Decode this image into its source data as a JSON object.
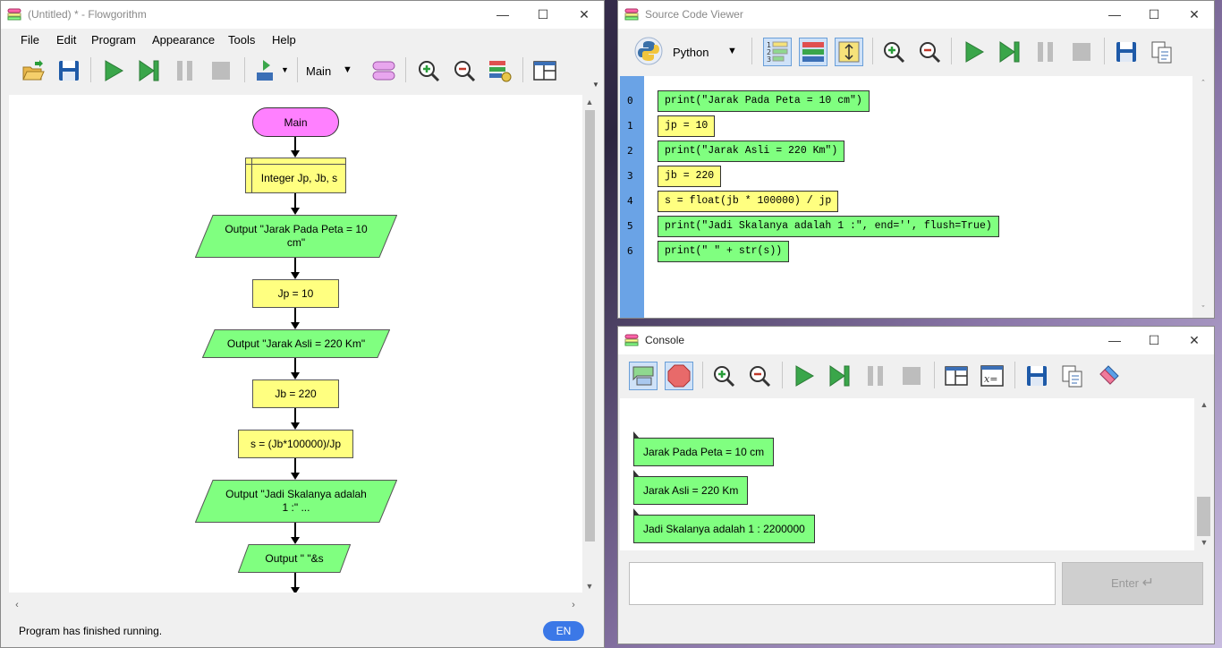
{
  "flowgorithm": {
    "title_prefix": "(Untitled) *",
    "title_sep": " - ",
    "title_app": "Flowgorithm",
    "menu": [
      "File",
      "Edit",
      "Program",
      "Appearance",
      "Tools",
      "Help"
    ],
    "function_select": "Main",
    "status": "Program has finished running.",
    "language_badge": "EN",
    "flowchart": {
      "start": "Main",
      "declare": "Integer Jp, Jb, s",
      "output1": "Output \"Jarak Pada Peta = 10 cm\"",
      "assign1": "Jp = 10",
      "output2": "Output \"Jarak Asli = 220 Km\"",
      "assign2": "Jb = 220",
      "assign3": "s = (Jb*100000)/Jp",
      "output3": "Output \"Jadi Skalanya adalah 1 :\" ...",
      "output4": "Output \" \"&s"
    }
  },
  "source_viewer": {
    "title": "Source Code Viewer",
    "language": "Python",
    "lines": [
      {
        "num": "0",
        "code": "print(\"Jarak Pada Peta = 10 cm\")",
        "color": "green"
      },
      {
        "num": "1",
        "code": "jp = 10",
        "color": "yellow"
      },
      {
        "num": "2",
        "code": "print(\"Jarak Asli = 220 Km\")",
        "color": "green"
      },
      {
        "num": "3",
        "code": "jb = 220",
        "color": "yellow"
      },
      {
        "num": "4",
        "code": "s = float(jb * 100000) / jp",
        "color": "yellow"
      },
      {
        "num": "5",
        "code": "print(\"Jadi Skalanya adalah 1 :\", end='', flush=True)",
        "color": "green"
      },
      {
        "num": "6",
        "code": "print(\" \" + str(s))",
        "color": "green"
      }
    ]
  },
  "console": {
    "title": "Console",
    "messages": [
      "Jarak Pada Peta = 10 cm",
      "Jarak Asli = 220 Km",
      "Jadi Skalanya adalah 1 : 2200000"
    ],
    "input_value": "",
    "enter_label": "Enter"
  },
  "colors": {
    "green": "#80ff80",
    "yellow": "#ffff80",
    "start_magenta": "#ff80ff",
    "gutter_blue": "#6aa3e6",
    "badge_blue": "#3b78e7"
  }
}
